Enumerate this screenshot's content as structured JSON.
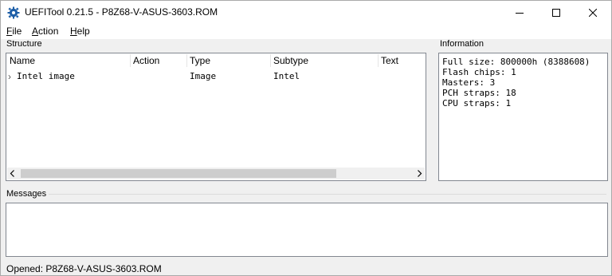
{
  "window": {
    "title": "UEFITool 0.21.5 - P8Z68-V-ASUS-3603.ROM"
  },
  "menu": {
    "file_first": "F",
    "file_rest": "ile",
    "action_first": "A",
    "action_rest": "ction",
    "help_first": "H",
    "help_rest": "elp"
  },
  "structure": {
    "label": "Structure",
    "columns": [
      "Name",
      "Action",
      "Type",
      "Subtype",
      "Text"
    ],
    "rows": [
      {
        "expander": "›",
        "name": "Intel image",
        "action": "",
        "type": "Image",
        "subtype": "Intel",
        "text": ""
      }
    ]
  },
  "information": {
    "label": "Information",
    "lines": [
      "Full size: 800000h (8388608)",
      "Flash chips: 1",
      "Masters: 3",
      "PCH straps: 18",
      "CPU straps: 1"
    ]
  },
  "messages": {
    "label": "Messages"
  },
  "status": {
    "text": "Opened: P8Z68-V-ASUS-3603.ROM"
  },
  "icons": {
    "app": "gear-icon",
    "minimize": "minimize-icon",
    "maximize": "maximize-icon",
    "close": "close-icon",
    "scroll_left": "chevron-left-icon",
    "scroll_right": "chevron-right-icon",
    "expander": "chevron-right-icon"
  },
  "colors": {
    "panel_border": "#828790",
    "window_bg": "#f0f0f0",
    "scroll_thumb": "#cdcdcd",
    "app_icon": "#1e5fa8"
  }
}
